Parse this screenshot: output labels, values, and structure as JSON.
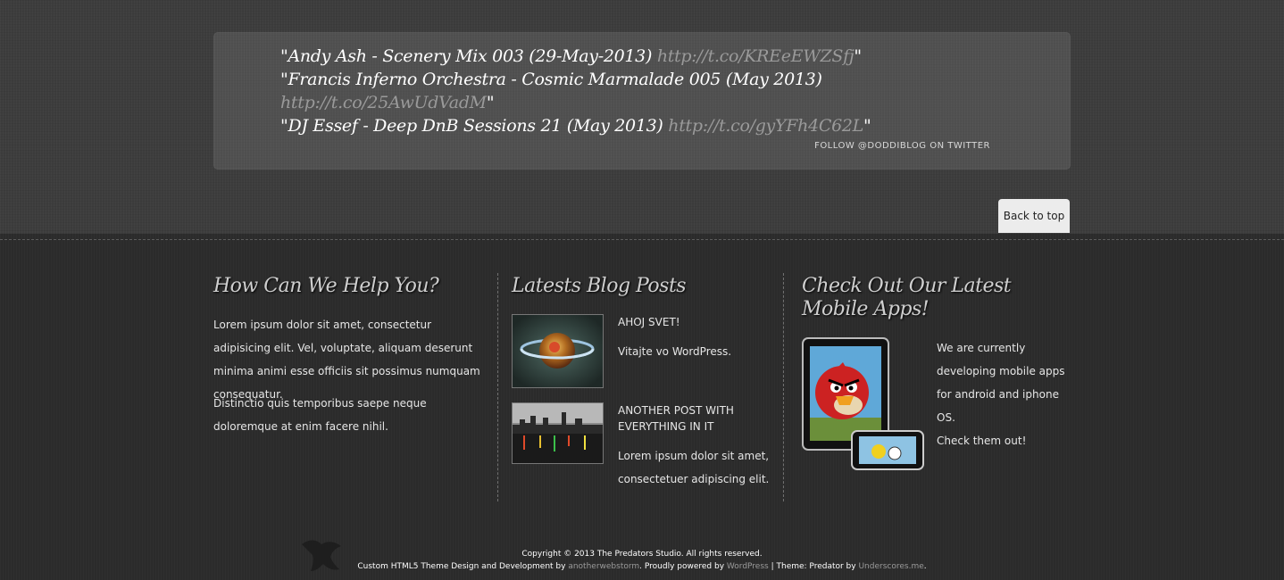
{
  "tweets": {
    "items": [
      {
        "text": "\"Andy Ash - Scenery Mix 003 (29-May-2013) ",
        "link": "http://t.co/KREeEWZSfj",
        "end": "\""
      },
      {
        "text": "\"Francis Inferno Orchestra - Cosmic Marmalade 005 (May 2013) ",
        "link": "http://t.co/25AwUdVadM",
        "end": "\""
      },
      {
        "text": "\"DJ Essef - Deep DnB Sessions 21 (May 2013) ",
        "link": "http://t.co/gyYFh4C62L",
        "end": "\""
      }
    ],
    "follow": "FOLLOW @DODDIBLOG ON TWITTER"
  },
  "back_to_top": "Back to top",
  "help": {
    "heading": "How Can We Help You?",
    "para1": "Lorem ipsum dolor sit amet, consectetur adipisicing elit. Vel, voluptate, aliquam deserunt minima animi esse officiis sit possimus numquam consequatur.",
    "para2": "Distinctio quis temporibus saepe neque doloremque at enim facere nihil."
  },
  "blog": {
    "heading": "Latests Blog Posts",
    "posts": [
      {
        "title": "AHOJ SVET!",
        "excerpt": "Vitajte vo WordPress."
      },
      {
        "title": "ANOTHER POST WITH EVERYTHING IN IT",
        "excerpt": "Lorem ipsum dolor sit amet, consectetuer adipiscing elit."
      }
    ]
  },
  "apps": {
    "heading": "Check Out Our Latest Mobile Apps!",
    "text": "We are currently developing mobile apps for android and iphone OS.",
    "cta": "Check them out!"
  },
  "footer": {
    "copyright": "Copyright © 2013 The Predators Studio. All rights reserved.",
    "credit_prefix": "Custom HTML5 Theme Design and Development by ",
    "credit_author": "anotherwebstorm",
    "credit_mid": ". Proudly powered by ",
    "credit_wp": "WordPress",
    "credit_theme_label": " | Theme: Predator by ",
    "credit_us": "Underscores.me",
    "credit_end": "."
  }
}
